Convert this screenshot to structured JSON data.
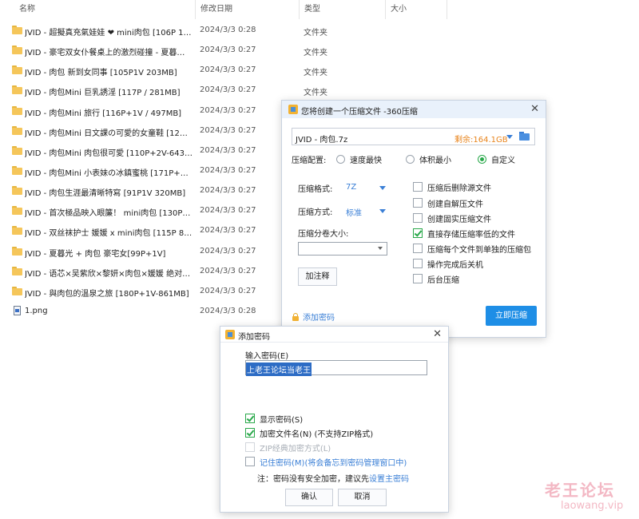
{
  "columns": {
    "name": "名称",
    "date": "修改日期",
    "type": "类型",
    "size": "大小"
  },
  "files": [
    {
      "name": "JVID - 超擬真充氣娃娃 ❤ mini肉包 [106P 1V...",
      "date": "2024/3/3 0:28",
      "type": "文件夹",
      "icon": "folder"
    },
    {
      "name": "JVID - 豪宅双女仆餐桌上的激烈碰撞 - 夏暮光 x...",
      "date": "2024/3/3 0:27",
      "type": "文件夹",
      "icon": "folder"
    },
    {
      "name": "JVID - 肉包 新到女同事 [105P1V 203MB]",
      "date": "2024/3/3 0:27",
      "type": "文件夹",
      "icon": "folder"
    },
    {
      "name": "JVID - 肉包Mini 巨乳誘淫 [117P / 281MB]",
      "date": "2024/3/3 0:27",
      "type": "文件夹",
      "icon": "folder"
    },
    {
      "name": "JVID - 肉包Mini 旅行 [116P+1V / 497MB]",
      "date": "2024/3/3 0:27",
      "type": "",
      "icon": "folder"
    },
    {
      "name": "JVID - 肉包Mini 日文課の可愛的女童鞋 [129P...",
      "date": "2024/3/3 0:27",
      "type": "",
      "icon": "folder"
    },
    {
      "name": "JVID - 肉包Mini 肉包很可愛 [110P+2V-643M...",
      "date": "2024/3/3 0:27",
      "type": "",
      "icon": "folder"
    },
    {
      "name": "JVID - 肉包Mini 小表妹の冰鎮蜜桃 [171P+1V...",
      "date": "2024/3/3 0:27",
      "type": "",
      "icon": "folder"
    },
    {
      "name": "JVID - 肉包生涯最清晰特寫 [91P1V 320MB]",
      "date": "2024/3/3 0:27",
      "type": "",
      "icon": "folder"
    },
    {
      "name": "JVID - 首次極品映入眼簾！ mini肉包 [130P 1...",
      "date": "2024/3/3 0:27",
      "type": "",
      "icon": "folder"
    },
    {
      "name": "JVID - 双丝袜护士 媛媛 x mini肉包 [115P 856...",
      "date": "2024/3/3 0:27",
      "type": "",
      "icon": "folder"
    },
    {
      "name": "JVID - 夏暮光 + 肉包 豪宅女[99P+1V]",
      "date": "2024/3/3 0:27",
      "type": "",
      "icon": "folder"
    },
    {
      "name": "JVID - 语芯×吴紫欣×黎妍×肉包×媛媛 绝对颜...",
      "date": "2024/3/3 0:27",
      "type": "",
      "icon": "folder"
    },
    {
      "name": "JVID - 與肉包的溫泉之旅 [180P+1V-861MB]",
      "date": "2024/3/3 0:27",
      "type": "",
      "icon": "folder"
    },
    {
      "name": "1.png",
      "date": "2024/3/3 0:28",
      "type": "",
      "icon": "image-file"
    }
  ],
  "compress_dialog": {
    "title": "您将创建一个压缩文件 -360压缩",
    "archive_name": "JVID - 肉包.7z",
    "free_space": "剩余:164.1GB",
    "config_label": "压缩配置:",
    "radio_options": [
      {
        "label": "速度最快",
        "selected": false
      },
      {
        "label": "体积最小",
        "selected": false
      },
      {
        "label": "自定义",
        "selected": true
      }
    ],
    "format_label": "压缩格式:",
    "format_value": "7Z",
    "method_label": "压缩方式:",
    "method_value": "标准",
    "volume_label": "压缩分卷大小:",
    "volume_value": "",
    "comment_button": "加注释",
    "options": [
      {
        "label": "压缩后删除源文件",
        "checked": false
      },
      {
        "label": "创建自解压文件",
        "checked": false
      },
      {
        "label": "创建固实压缩文件",
        "checked": false
      },
      {
        "label": "直接存储压缩率低的文件",
        "checked": true
      },
      {
        "label": "压缩每个文件到单独的压缩包",
        "checked": false
      },
      {
        "label": "操作完成后关机",
        "checked": false
      },
      {
        "label": "后台压缩",
        "checked": false
      }
    ],
    "add_password_link": "添加密码",
    "compress_button": "立即压缩",
    "accent_color": "#1e8ee6"
  },
  "password_dialog": {
    "title": "添加密码",
    "input_label": "输入密码(E)",
    "password_value": "上老王论坛当老王",
    "checkboxes": [
      {
        "label": "显示密码(S)",
        "checked": true,
        "enabled": true
      },
      {
        "label": "加密文件名(N) (不支持ZIP格式)",
        "checked": true,
        "enabled": true
      },
      {
        "label": "ZIP经典加密方式(L)",
        "checked": false,
        "enabled": false
      },
      {
        "label": "记住密码(M)",
        "suffix": " (将会备忘到密码管理窗口中)",
        "checked": false,
        "enabled": true
      }
    ],
    "note_prefix": "注：密码没有安全加密，建议先",
    "note_link": "设置主密码",
    "ok_button": "确认",
    "cancel_button": "取消"
  },
  "watermark": {
    "title": "老王论坛",
    "url": "laowang.vip"
  }
}
